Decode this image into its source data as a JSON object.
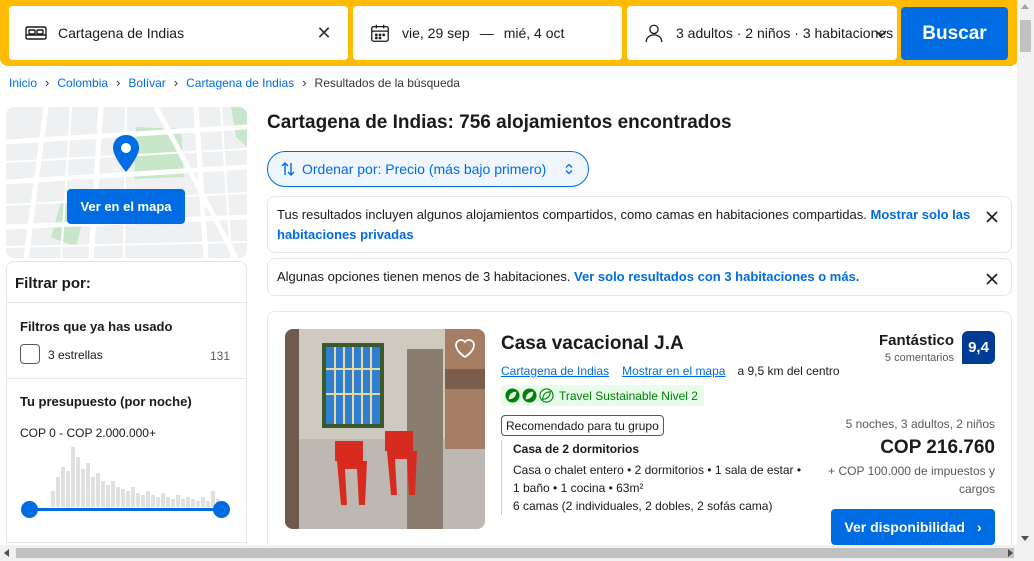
{
  "search": {
    "destination": "Cartagena de Indias",
    "checkin": "vie, 29 sep",
    "date_separator": "—",
    "checkout": "mié, 4 oct",
    "guests": "3 adultos · 2 niños · 3 habitaciones",
    "button_label": "Buscar"
  },
  "breadcrumb": [
    {
      "label": "Inicio"
    },
    {
      "label": "Colombia"
    },
    {
      "label": "Bolívar"
    },
    {
      "label": "Cartagena de Indias"
    },
    {
      "label": "Resultados de la búsqueda"
    }
  ],
  "map": {
    "button_label": "Ver en el mapa"
  },
  "filters": {
    "title": "Filtrar por:",
    "used_heading": "Filtros que ya has usado",
    "used_items": [
      {
        "label": "3 estrellas",
        "count": "131",
        "checked": false
      }
    ],
    "budget_heading": "Tu presupuesto (por noche)",
    "budget_range": "COP 0 - COP 2.000.000+",
    "budget_min_fraction": 0,
    "budget_max_fraction": 1
  },
  "results": {
    "title": "Cartagena de Indias: 756 alojamientos encontrados",
    "sort_label": "Ordenar por: Precio (más bajo primero)",
    "notices": [
      {
        "text": "Tus resultados incluyen algunos alojamientos compartidos, como camas en habitaciones compartidas. ",
        "link": "Mostrar solo las habitaciones privadas"
      },
      {
        "text": "Algunas opciones tienen menos de 3 habitaciones. ",
        "link": "Ver solo resultados con 3 habitaciones o más."
      }
    ]
  },
  "property": {
    "name": "Casa vacacional J.A",
    "location_link": "Cartagena de Indias",
    "map_link": "Mostrar en el mapa",
    "distance": "a 9,5 km del centro",
    "sustainability": "Travel Sustainable Nivel 2",
    "recommended_badge": "Recomendado para tu grupo",
    "unit_title": "Casa de 2 dormitorios",
    "unit_line1": "Casa o chalet entero • 2 dormitorios • 1 sala de estar •",
    "unit_line2": "1 baño • 1 cocina • 63m²",
    "unit_line3": "6 camas (2 individuales, 2 dobles, 2 sofás cama)",
    "rating_word": "Fantástico",
    "review_count": "5 comentarios",
    "score": "9,4",
    "stay_summary": "5 noches, 3 adultos, 2 niños",
    "price": "COP 216.760",
    "taxes": "+ COP 100.000 de impuestos y cargos",
    "cta_label": "Ver disponibilidad"
  },
  "colors": {
    "brand_blue": "#006ce4",
    "search_yellow": "#febb02",
    "score_navy": "#003b95",
    "sustain_green": "#008009"
  }
}
